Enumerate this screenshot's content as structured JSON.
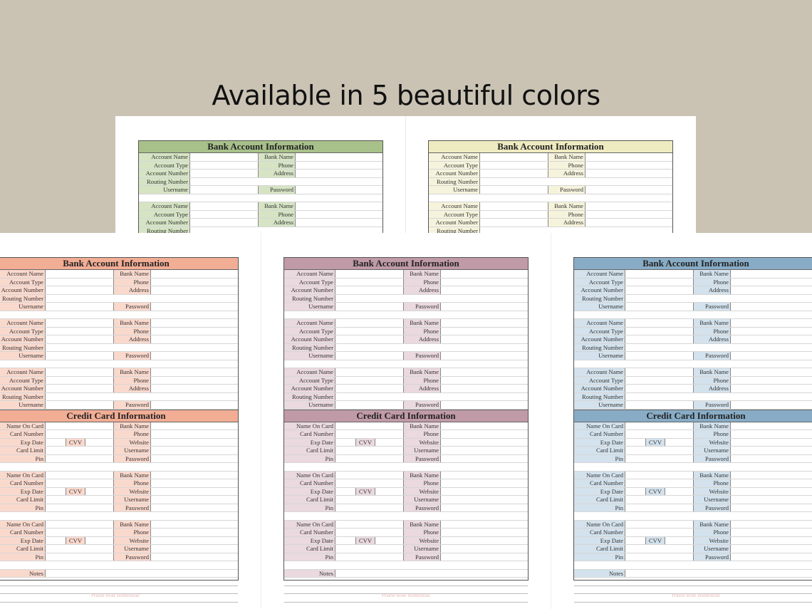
{
  "headline": "Available in 5 beautiful colors",
  "bank_title": "Bank Account Information",
  "credit_title": "Credit Card Information",
  "bank_left_labels": [
    "Account Name",
    "Account Type",
    "Account Number",
    "Routing Number",
    "Username"
  ],
  "bank_right_labels": [
    "Bank Name",
    "Phone",
    "Address",
    "",
    "Password"
  ],
  "card_left_labels": [
    "Name On Card",
    "Card Number",
    "Exp Date",
    "Card Limit",
    "Pin"
  ],
  "card_right_labels": [
    "Bank Name",
    "Phone",
    "Website",
    "Username",
    "Password"
  ],
  "cvv_label": "CVV",
  "notes_label": "Notes",
  "footer": "Prairie Rose Homestead",
  "colors": {
    "background": "#cac3b4",
    "green": "#a8c08a",
    "green_label": "#d6e4c4",
    "yellow": "#efebc0",
    "yellow_label": "#f6f3dc",
    "peach": "#f2ad95",
    "peach_label": "#fad9cd",
    "mauve": "#c09aa7",
    "mauve_label": "#ead9df",
    "blue": "#88acc6",
    "blue_label": "#d3e2ed"
  }
}
